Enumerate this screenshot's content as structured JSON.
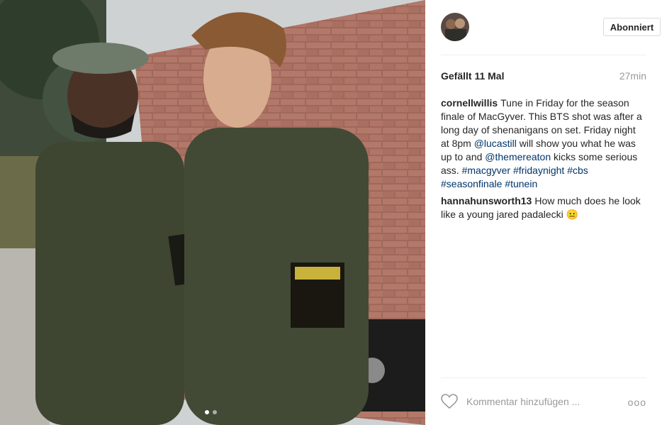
{
  "post": {
    "photo": {
      "alt_icon": "photo-content",
      "carousel_dots": 2,
      "active_dot": 1
    },
    "header": {
      "follow_button": "Abonniert"
    },
    "likes": "Gefällt 11 Mal",
    "time": "27min",
    "caption": {
      "username": "cornellwillis",
      "text_1": "Tune in Friday for the season finale of MacGyver. This BTS shot was after a long day of shenanigans on set. Friday night at 8pm ",
      "mention_1": "@lucastill",
      "text_2": " will show you what he was up to and ",
      "mention_2": "@themereaton",
      "text_3": " kicks some serious ass. ",
      "hashtags": [
        "#macgyver",
        "#fridaynight",
        "#cbs",
        "#seasonfinale",
        "#tunein"
      ]
    },
    "comments": [
      {
        "username": "hannahunsworth13",
        "text": "How much does he look like a young jared padalecki 😐"
      }
    ],
    "add_comment_placeholder": "Kommentar hinzufügen ...",
    "more_options": "ooo"
  }
}
